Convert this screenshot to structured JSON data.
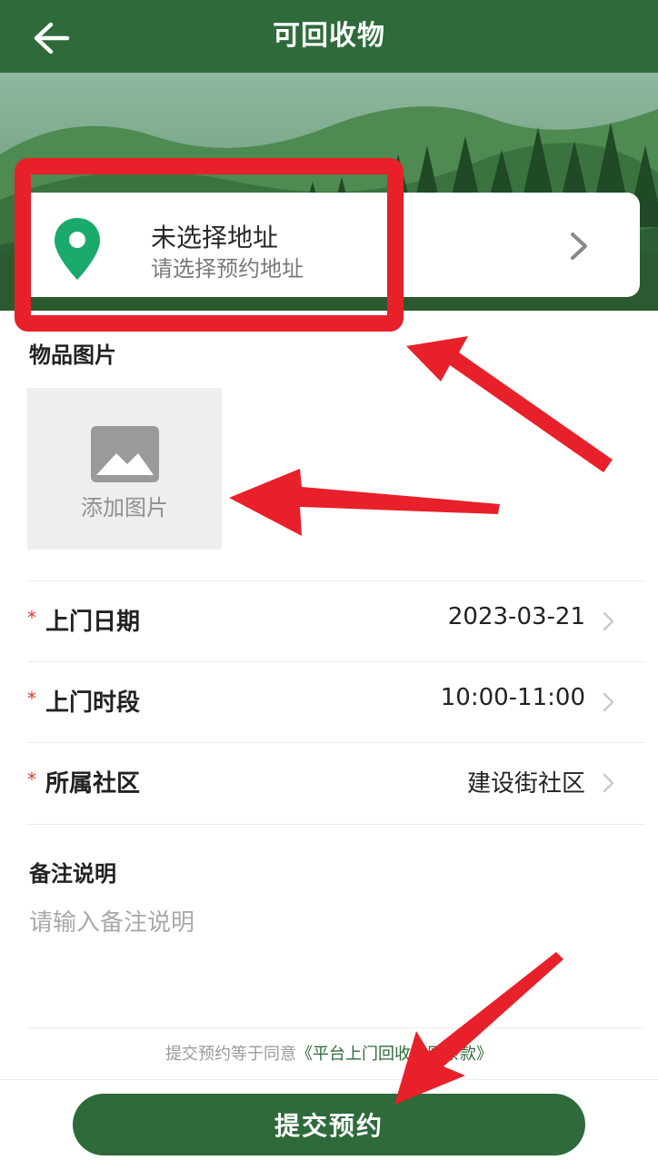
{
  "header": {
    "title": "可回收物",
    "back_icon": "arrow-left-icon"
  },
  "address": {
    "title": "未选择地址",
    "placeholder": "请选择预约地址",
    "pin_icon": "location-pin-icon",
    "pin_color": "#1aaa6b"
  },
  "photos": {
    "section_label": "物品图片",
    "add_label": "添加图片",
    "icon": "image-icon"
  },
  "form": {
    "rows": [
      {
        "label": "上门日期",
        "value": "2023-03-21",
        "required": "*"
      },
      {
        "label": "上门时段",
        "value": "10:00-11:00",
        "required": "*"
      },
      {
        "label": "所属社区",
        "value": "建设街社区",
        "required": "*"
      }
    ]
  },
  "remark": {
    "label": "备注说明",
    "placeholder": "请输入备注说明"
  },
  "agreement": {
    "prefix": "提交预约等于同意",
    "link": "《平台上门回收规则条款》"
  },
  "submit": {
    "label": "提交预约"
  },
  "theme": {
    "primary": "#2e6a3a",
    "annotation": "#e8202a"
  }
}
